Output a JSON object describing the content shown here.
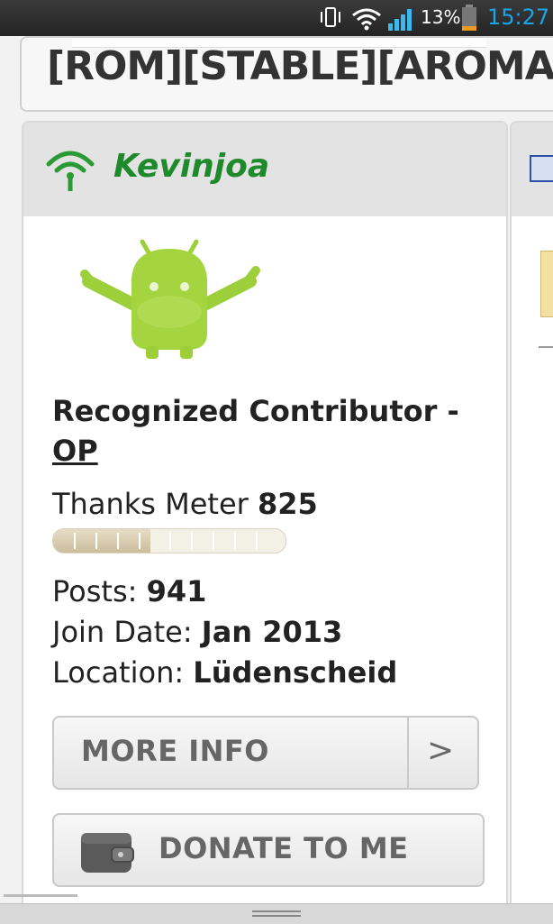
{
  "status_bar": {
    "battery_percent": "13%",
    "time": "15:27",
    "icons": [
      "vibrate-icon",
      "wifi-icon",
      "signal-icon",
      "battery-icon"
    ],
    "time_color": "#1aa6e6"
  },
  "thread": {
    "title": "[ROM][STABLE][AROMA][Ma"
  },
  "profile": {
    "username": "Kevinjoa",
    "username_color": "#1f8a2c",
    "online_icon": "online-signal-icon",
    "title": "Recognized Contributor -",
    "title_link": "OP",
    "thanks_label": "Thanks Meter",
    "thanks_value": "825",
    "thanks_meter_fill_fraction": 0.42,
    "posts_label": "Posts:",
    "posts_value": "941",
    "join_label": "Join Date:",
    "join_value": "Jan 2013",
    "location_label": "Location:",
    "location_value": "Lüdenscheid"
  },
  "buttons": {
    "more_info": "MORE INFO",
    "more_info_chevron": ">",
    "donate": "DONATE TO ME"
  }
}
